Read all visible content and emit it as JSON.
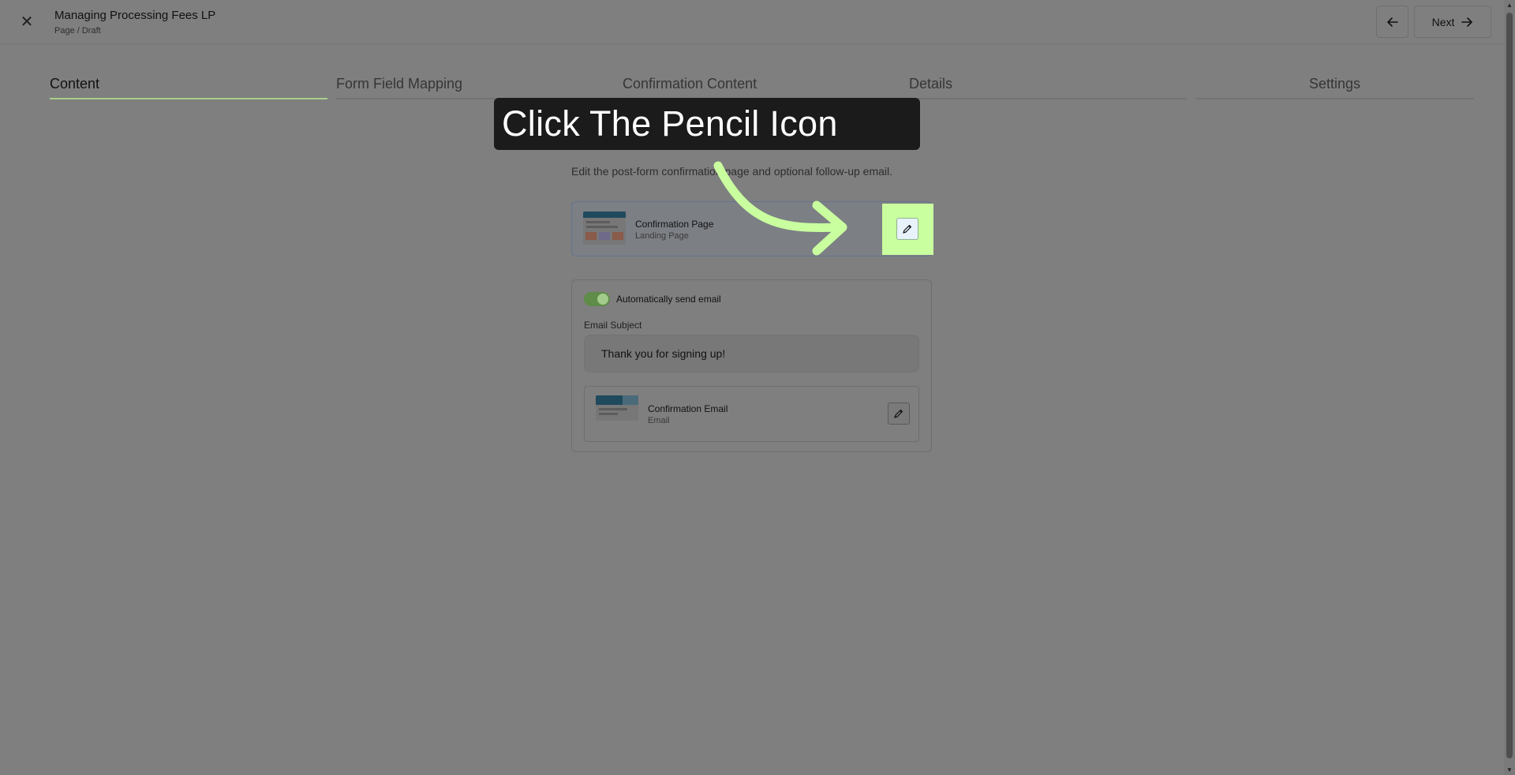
{
  "header": {
    "title": "Managing Processing Fees LP",
    "breadcrumb": "Page / Draft",
    "next_label": "Next"
  },
  "tabs": [
    {
      "label": "Content",
      "active": true
    },
    {
      "label": "Form Field Mapping",
      "active": false
    },
    {
      "label": "Confirmation Content",
      "active": false
    },
    {
      "label": "Details",
      "active": false
    },
    {
      "label": "Settings",
      "active": false
    }
  ],
  "section": {
    "title": "Confirmation Content",
    "description": "Edit the post-form confirmation page and optional follow-up email."
  },
  "confirmation_page": {
    "name": "Confirmation Page",
    "type": "Landing Page"
  },
  "email": {
    "toggle_label": "Automatically send email",
    "toggle_on": true,
    "subject_label": "Email Subject",
    "subject_value": "Thank you for signing up!",
    "card_name": "Confirmation Email",
    "card_type": "Email"
  },
  "guide": {
    "tooltip_text": "Click The Pencil Icon",
    "highlight_color": "#c9ff9f"
  },
  "colors": {
    "accent": "#a8d08a",
    "toggle": "#5f8c48"
  }
}
